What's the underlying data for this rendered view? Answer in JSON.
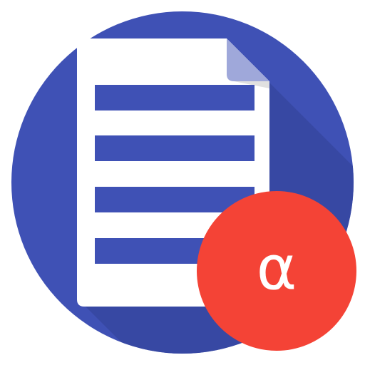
{
  "app_icon": {
    "name": "document-app-icon",
    "badge": {
      "glyph": "α",
      "glyph_name": "alpha-icon"
    },
    "colors": {
      "circle": "#3F51B5",
      "long_shadow": "#35459E",
      "page": "#FFFFFF",
      "page_fold": "#9FA8DA",
      "text_lines": "#3F51B5",
      "badge": "#F44336",
      "badge_glyph": "#FFFFFF"
    }
  }
}
